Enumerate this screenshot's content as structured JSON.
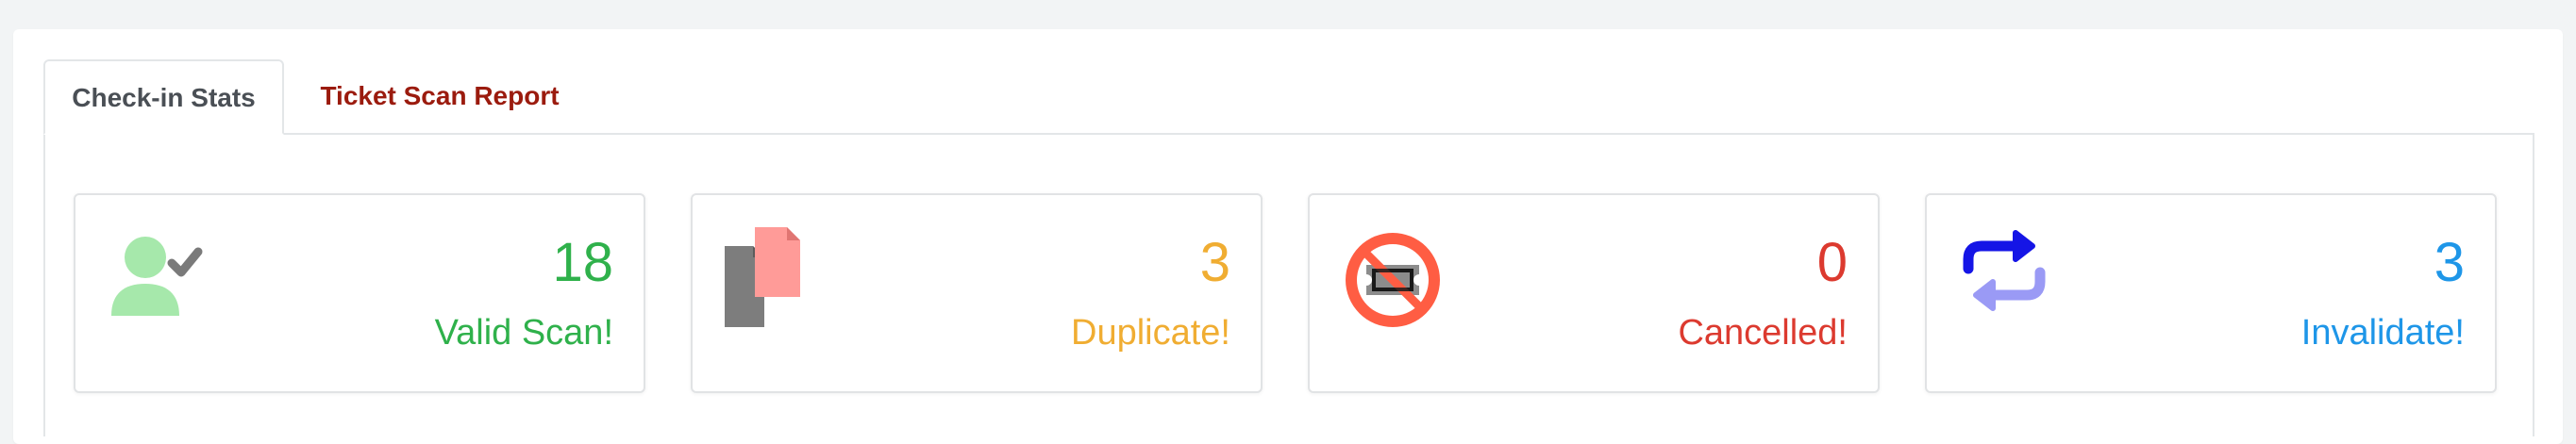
{
  "tabs": [
    {
      "label": "Check-in Stats",
      "active": true
    },
    {
      "label": "Ticket Scan Report",
      "active": false
    }
  ],
  "stats": [
    {
      "value": "18",
      "label": "Valid Scan!",
      "color": "#2fb14b",
      "icon": "user-check-icon"
    },
    {
      "value": "3",
      "label": "Duplicate!",
      "color": "#f0ad32",
      "icon": "duplicate-files-icon"
    },
    {
      "value": "0",
      "label": "Cancelled!",
      "color": "#dc3a2f",
      "icon": "cancelled-ticket-icon"
    },
    {
      "value": "3",
      "label": "Invalidate!",
      "color": "#1e96e8",
      "icon": "repeat-arrows-icon"
    }
  ],
  "colors": {
    "tab_active_text": "#4a4f55",
    "tab_inactive_text": "#9b1b0e"
  }
}
